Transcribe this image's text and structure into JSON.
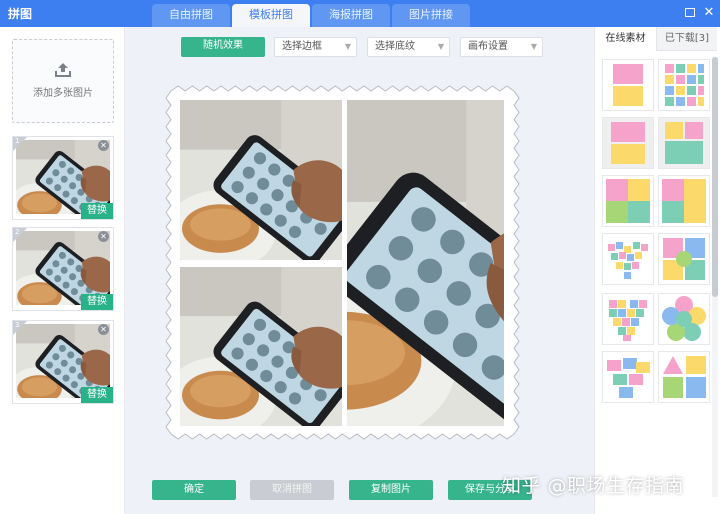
{
  "app": {
    "title": "拼图"
  },
  "tabs": [
    {
      "label": "自由拼图",
      "active": false
    },
    {
      "label": "模板拼图",
      "active": true
    },
    {
      "label": "海报拼图",
      "active": false
    },
    {
      "label": "图片拼接",
      "active": false
    }
  ],
  "left_panel": {
    "add_label": "添加多张图片",
    "thumbnails": [
      {
        "index": "1",
        "replace_label": "替换"
      },
      {
        "index": "2",
        "replace_label": "替换"
      },
      {
        "index": "3",
        "replace_label": "替换"
      }
    ]
  },
  "toolbar": {
    "random_label": "随机效果",
    "border_select": "选择边框",
    "texture_select": "选择底纹",
    "canvas_select": "画布设置"
  },
  "bottom_bar": {
    "confirm_label": "确定",
    "cancel_label": "取消拼图",
    "copy_label": "复制图片",
    "save_label": "保存与分享"
  },
  "right_panel": {
    "tab_online": "在线素材",
    "tab_downloaded": "已下载[3]"
  },
  "watermark": "知乎 @职场生存指南",
  "colors": {
    "titlebar": "#3d7ff0",
    "accent_green": "#36b48c",
    "replace_green": "#27b287",
    "disabled_grey": "#c9ccd2"
  }
}
